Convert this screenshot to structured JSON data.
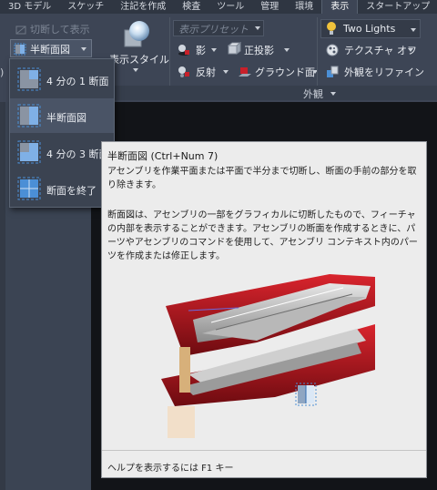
{
  "tabs": [
    {
      "label": "3D モデル",
      "active": false
    },
    {
      "label": "スケッチ",
      "active": false
    },
    {
      "label": "注記を作成",
      "active": false
    },
    {
      "label": "検査",
      "active": false
    },
    {
      "label": "ツール",
      "active": false
    },
    {
      "label": "管理",
      "active": false
    },
    {
      "label": "環境",
      "active": false
    },
    {
      "label": "表示",
      "active": true
    },
    {
      "label": "スタートアップ",
      "active": false
    }
  ],
  "ribbon": {
    "cut_display": "切断して表示",
    "half_section": "半断面図",
    "display_style": "表示スタイル",
    "preset": "表示プリセット",
    "shadow": "影",
    "reflection": "反射",
    "orthographic": "正投影",
    "ground_plane": "グラウンド面",
    "lighting": "Two Lights",
    "texture": "テクスチャ オフ",
    "refine_appearance": "外観をリファイン",
    "panel_appearance": "外観",
    "left_edge": ")"
  },
  "dropdown": {
    "items": [
      {
        "label": "4 分の 1 断面"
      },
      {
        "label": "半断面図"
      },
      {
        "label": "4 分の 3 断面"
      },
      {
        "label": "断面を終了"
      }
    ]
  },
  "tooltip": {
    "title": "半断面図 (Ctrl+Num 7)",
    "desc1": "アセンブリを作業平面または平面で半分まで切断し、断面の手前の部分を取り除きます。",
    "desc2": "断面図は、アセンブリの一部をグラフィカルに切断したもので、フィーチャの内部を表示することができます。アセンブリの断面を作成するときに、パーツやアセンブリのコマンドを使用して、アセンブリ コンテキスト内のパーツを作成または修正します。",
    "help": "ヘルプを表示するには F1 キー"
  },
  "colors": {
    "accent": "#4b8fd6",
    "ribbon_bg": "#3d4555",
    "canvas_bg": "#121418",
    "tooltip_bg": "#ececec",
    "part_red": "#b3151d"
  }
}
